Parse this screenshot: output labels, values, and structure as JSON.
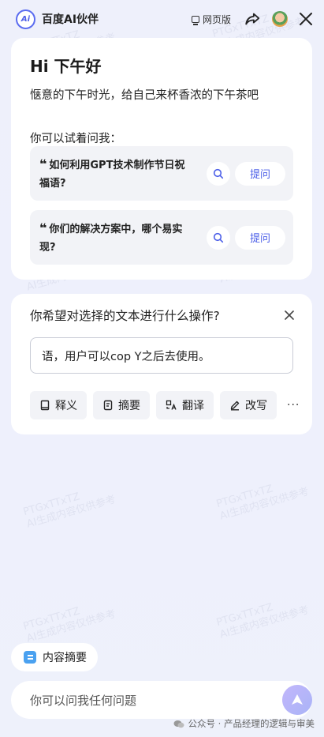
{
  "header": {
    "logo_text": "Ai",
    "title": "百度AI伙伴",
    "web_version_label": "网页版",
    "icons": [
      "monitor-icon",
      "share-icon",
      "avatar-icon",
      "close-icon"
    ]
  },
  "greeting": {
    "title": "Hi 下午好",
    "subtitle": "惬意的下午时光，给自己来杯香浓的下午茶吧",
    "try_label": "你可以试着问我："
  },
  "suggestions": [
    {
      "quote": "❝",
      "line1": "如何利用GPT技术制作节日祝",
      "line2": "福语?",
      "ask_label": "提问"
    },
    {
      "quote": "❝",
      "line1": "你们的解决方案中，哪个易实",
      "line2": "现?",
      "ask_label": "提问"
    }
  ],
  "operation": {
    "question": "你希望对选择的文本进行什么操作?",
    "selected_text": "语，用户可以cop Y之后去使用。",
    "actions": [
      {
        "label": "释义",
        "icon": "book-icon"
      },
      {
        "label": "摘要",
        "icon": "document-icon"
      },
      {
        "label": "翻译",
        "icon": "translate-icon"
      },
      {
        "label": "改写",
        "icon": "pen-icon"
      }
    ],
    "more_label": "···"
  },
  "bottom": {
    "summary_chip": "内容摘要",
    "input_placeholder": "你可以问我任何问题",
    "footer_note": "公众号 · 产品经理的逻辑与审美"
  },
  "watermark": {
    "line1": "PTGxTTxTZ",
    "line2": "AI生成内容仅供参考"
  },
  "colors": {
    "accent": "#4b5ee8",
    "background": "#eef0fb",
    "card": "#ffffff",
    "chip": "#f2f3f7"
  }
}
